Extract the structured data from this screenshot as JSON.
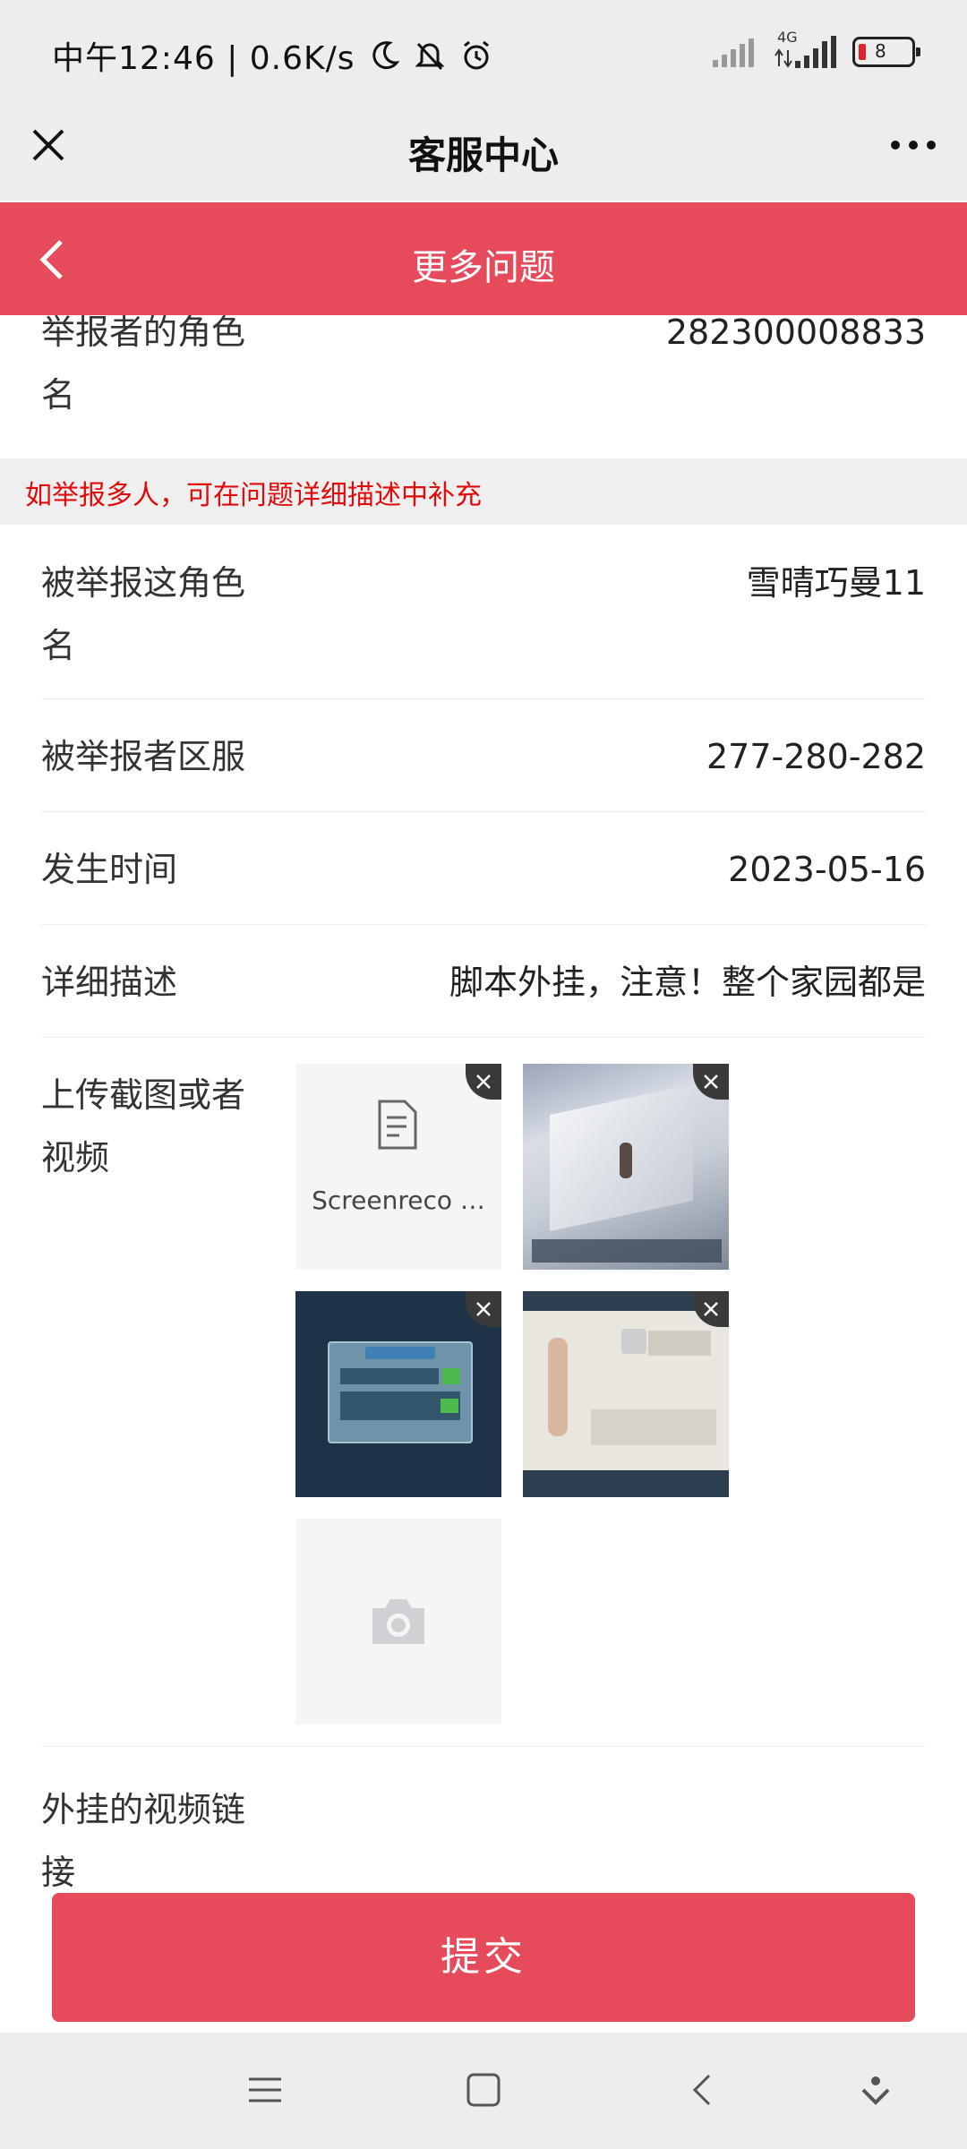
{
  "status_bar": {
    "left_text": "中午12:46 | 0.6K/s",
    "icons": [
      "moon-icon",
      "bell-off-icon",
      "alarm-icon"
    ],
    "right_icons": [
      "signal-icon",
      "4g-signal-icon",
      "battery-icon"
    ],
    "network_label": "4G",
    "battery_level": "8"
  },
  "header": {
    "title": "客服中心",
    "close_icon": "close-icon",
    "more_icon": "more-icon"
  },
  "subheader": {
    "title": "更多问题",
    "back_icon": "chevron-left-icon"
  },
  "form": {
    "reporter_role_label": "举报者的角色名",
    "reporter_role_value": "282300008833",
    "notice": "如举报多人，可在问题详细描述中补充",
    "reported_role_label": "被举报这角色名",
    "reported_role_value": "雪晴巧曼11",
    "reported_server_label": "被举报者区服",
    "reported_server_value": "277-280-282",
    "time_label": "发生时间",
    "time_value": "2023-05-16",
    "description_label": "详细描述",
    "description_value": "脚本外挂，注意！整个家园都是",
    "upload_label": "上传截图或者视频",
    "upload_items": [
      {
        "type": "file",
        "name": "Screenreco …"
      },
      {
        "type": "image",
        "desc": "game-screenshot-snow"
      },
      {
        "type": "image",
        "desc": "game-screenshot-friend-search"
      },
      {
        "type": "image",
        "desc": "game-screenshot-player-info"
      }
    ],
    "video_link_label": "外挂的视频链接"
  },
  "submit_label": "提交",
  "colors": {
    "accent": "#e64b5c",
    "notice_text": "#e00b0b",
    "bar_bg": "#ededed"
  }
}
